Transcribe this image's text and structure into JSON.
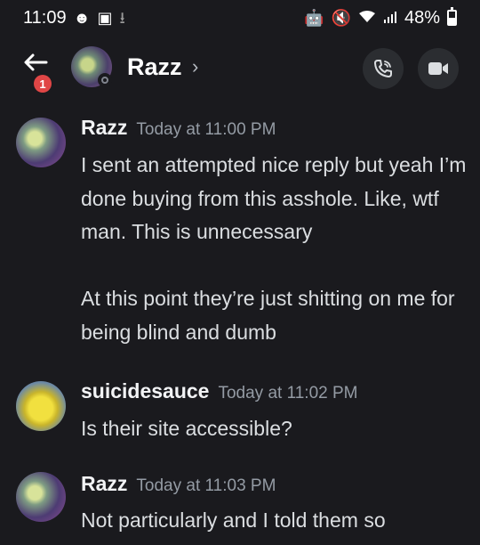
{
  "status_bar": {
    "time": "11:09",
    "battery": "48%",
    "left_icons": [
      "messenger-icon",
      "gallery-icon",
      "download-icon"
    ],
    "right_icons": [
      "robot-icon",
      "mute-icon",
      "wifi-icon",
      "signal-icon",
      "battery-icon"
    ]
  },
  "header": {
    "title": "Razz",
    "chevron": "›",
    "notification_count": "1",
    "actions": [
      "call-icon",
      "video-icon"
    ]
  },
  "messages": [
    {
      "author": "Razz",
      "time": "Today at 11:00 PM",
      "lines": [
        "I sent an attempted nice reply but yeah I’m done buying from this asshole. Like, wtf man. This is unnecessary",
        "At this point they’re just shitting on me for being blind and dumb"
      ]
    },
    {
      "author": "suicidesauce",
      "time": "Today at 11:02 PM",
      "lines": [
        "Is their site accessible?"
      ]
    },
    {
      "author": "Razz",
      "time": "Today at 11:03 PM",
      "lines": [
        "Not particularly and I told them so"
      ]
    }
  ]
}
